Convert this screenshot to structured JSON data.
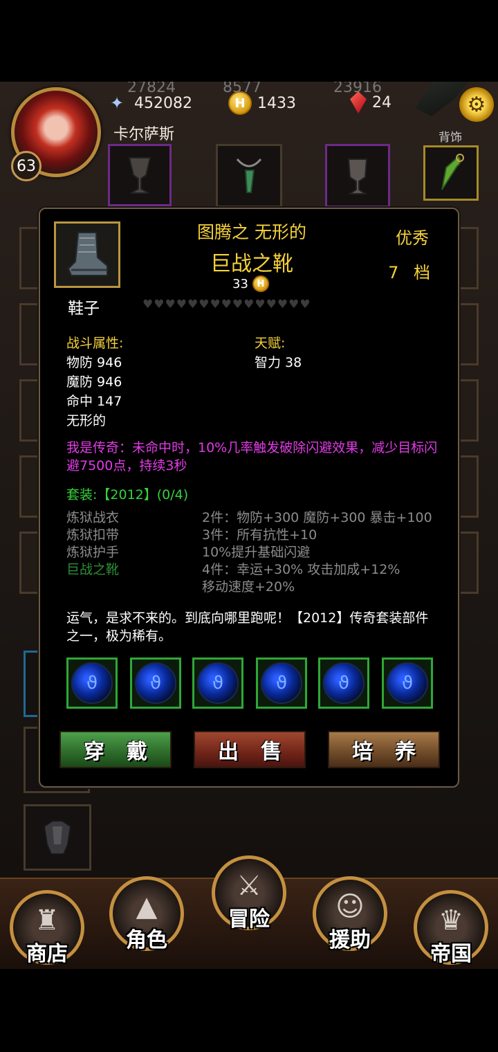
{
  "top_bar": {
    "ghost_values": [
      "27824",
      "8577",
      "23916"
    ],
    "power": "452082",
    "gold": "1433",
    "gems": "24",
    "character_name": "卡尔萨斯",
    "level": "63",
    "back_slot_label": "背饰",
    "icons": {
      "power": "staff-icon",
      "gold": "gold-coin-icon",
      "gems": "red-gem-icon",
      "settings": "gear-icon"
    }
  },
  "item_popup": {
    "title_prefix": "图腾之  无形的",
    "title_name": "巨战之靴",
    "price": "33",
    "quality": "优秀",
    "grade": "7 档",
    "item_type": "鞋子",
    "hearts": "♥♥♥♥♥♥♥♥♥♥♥♥♥♥♥",
    "combat_attrs_title": "战斗属性:",
    "combat_attrs": [
      "物防 946",
      "魔防 946",
      "命中 147",
      "无形的"
    ],
    "talent_title": "天赋:",
    "talents": [
      "智力 38"
    ],
    "legendary_effect": "我是传奇：未命中时，10%几率触发破除闪避效果，减少目标闪避7500点，持续3秒",
    "set_title": "套装:【2012】(0/4)",
    "set_pieces": [
      {
        "name": "炼狱战衣",
        "owned": false
      },
      {
        "name": "炼狱扣带",
        "owned": false
      },
      {
        "name": "炼狱护手",
        "owned": false
      },
      {
        "name": "巨战之靴",
        "owned": true
      }
    ],
    "set_bonuses": [
      "2件：物防+300 魔防+300 暴击+100",
      "3件：所有抗性+10",
      "10%提升基础闪避",
      "4件：幸运+30% 攻击加成+12%",
      "移动速度+20%"
    ],
    "flavor_text": "运气，是求不来的。到底向哪里跑呢！【2012】传奇套装部件之一，极为稀有。",
    "socket_count": 6,
    "buttons": {
      "wear": "穿戴",
      "sell": "出售",
      "train": "培养"
    }
  },
  "bottom_nav": [
    {
      "label": "商店",
      "icon": "castle-icon"
    },
    {
      "label": "角色",
      "icon": "hooded-figure-icon"
    },
    {
      "label": "冒险",
      "icon": "crossed-swords-icon"
    },
    {
      "label": "援助",
      "icon": "ally-girl-icon"
    },
    {
      "label": "帝国",
      "icon": "crown-icon"
    }
  ],
  "colors": {
    "gold_text": "#f5d23a",
    "legendary": "#e23be6",
    "set_green": "#33d43b",
    "inactive_grey": "#8c8c8c"
  }
}
